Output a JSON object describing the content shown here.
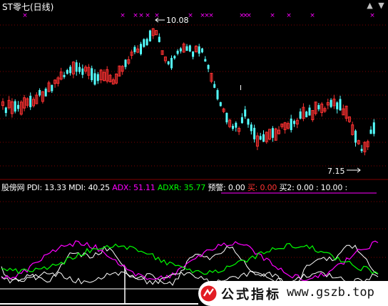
{
  "header": {
    "title": "ST零七(日线)"
  },
  "price_panel": {
    "high_label": "10.08",
    "low_label": "7.15",
    "colors": {
      "up": "#ff3232",
      "down": "#54ffff",
      "marker": "#ff00ff",
      "grid": "#800000"
    }
  },
  "indicator": {
    "name": "股傍网",
    "items": [
      {
        "label": "PDI:",
        "value": "13.33",
        "color": "#ffffff"
      },
      {
        "label": "MDI:",
        "value": "40.25",
        "color": "#ffffff"
      },
      {
        "label": "ADX:",
        "value": "51.11",
        "color": "#ff00ff"
      },
      {
        "label": "ADXR:",
        "value": "35.77",
        "color": "#00ff00"
      },
      {
        "label": "预警:",
        "value": "0.00",
        "color": "#ffffff"
      },
      {
        "label": "买:",
        "value": "0.00",
        "color": "#ff3232"
      },
      {
        "label": "买2:",
        "value": "0.00 : 10.00",
        "color": "#ffffff"
      }
    ],
    "trailing": ":",
    "colors": {
      "pdi": "#ffffff",
      "mdi": "#ff00ff",
      "adx": "#ff00ff",
      "adxr": "#00ff00",
      "ref": "#ffffff"
    }
  },
  "watermark": {
    "text": "公式指标",
    "url": "www.gszb.top"
  },
  "icons": {
    "up": "triangle-up-icon",
    "down": "triangle-down-icon"
  }
}
